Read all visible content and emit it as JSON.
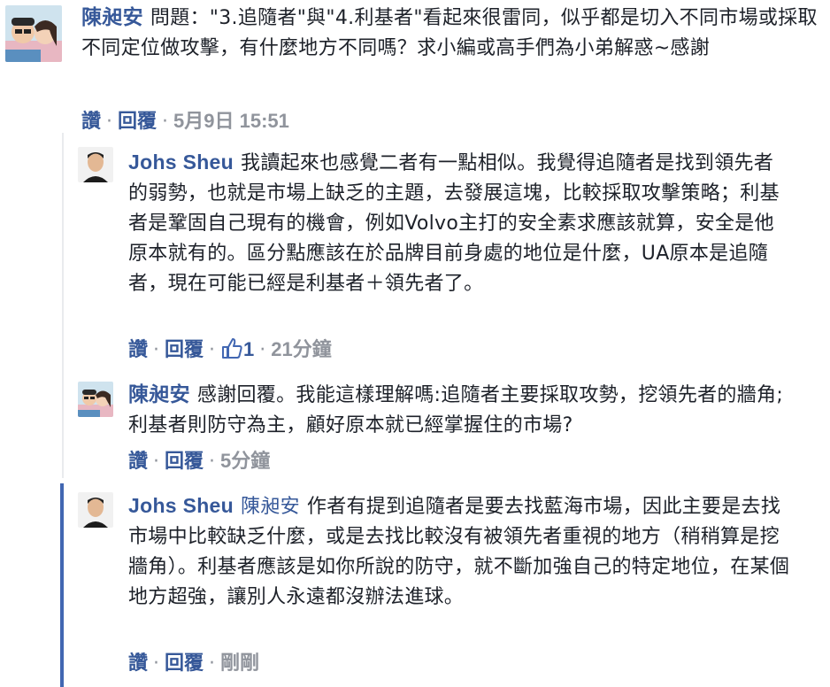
{
  "comments": [
    {
      "author": "陳昶安",
      "text": "問題：\"3.追隨者\"與\"4.利基者\"看起來很雷同，似乎都是切入不同市場或採取不同定位做攻擊，有什麼地方不同嗎？求小編或高手們為小弟解惑~感謝",
      "like_label": "讚",
      "reply_label": "回覆",
      "time": "5月9日 15:51"
    },
    {
      "author": "Johs Sheu",
      "text": "我讀起來也感覺二者有一點相似。我覺得追隨者是找到領先者的弱勢，也就是市場上缺乏的主題，去發展這塊，比較採取攻擊策略；利基者是鞏固自己現有的機會，例如Volvo主打的安全素求應該就算，安全是他原本就有的。區分點應該在於品牌目前身處的地位是什麼，UA原本是追隨者，現在可能已經是利基者＋領先者了。",
      "like_label": "讚",
      "reply_label": "回覆",
      "reaction_count": "1",
      "time": "21分鐘"
    },
    {
      "author": "陳昶安",
      "text": "感謝回覆。我能這樣理解嗎:追隨者主要採取攻勢，挖領先者的牆角;利基者則防守為主，顧好原本就已經掌握住的市場?",
      "like_label": "讚",
      "reply_label": "回覆",
      "time": "5分鐘"
    },
    {
      "author": "Johs Sheu",
      "mention": "陳昶安",
      "text": "作者有提到追隨者是要去找藍海市場，因此主要是去找市場中比較缺乏什麼，或是去找比較沒有被領先者重視的地方（稍稍算是挖牆角）。利基者應該是如你所說的防守，就不斷加強自己的特定地位，在某個地方超強，讓別人永遠都沒辦法進球。",
      "like_label": "讚",
      "reply_label": "回覆",
      "time": "剛剛"
    }
  ],
  "colors": {
    "link": "#365899",
    "meta": "#90949c",
    "text": "#1d2129",
    "active_thread": "#4267b2"
  }
}
